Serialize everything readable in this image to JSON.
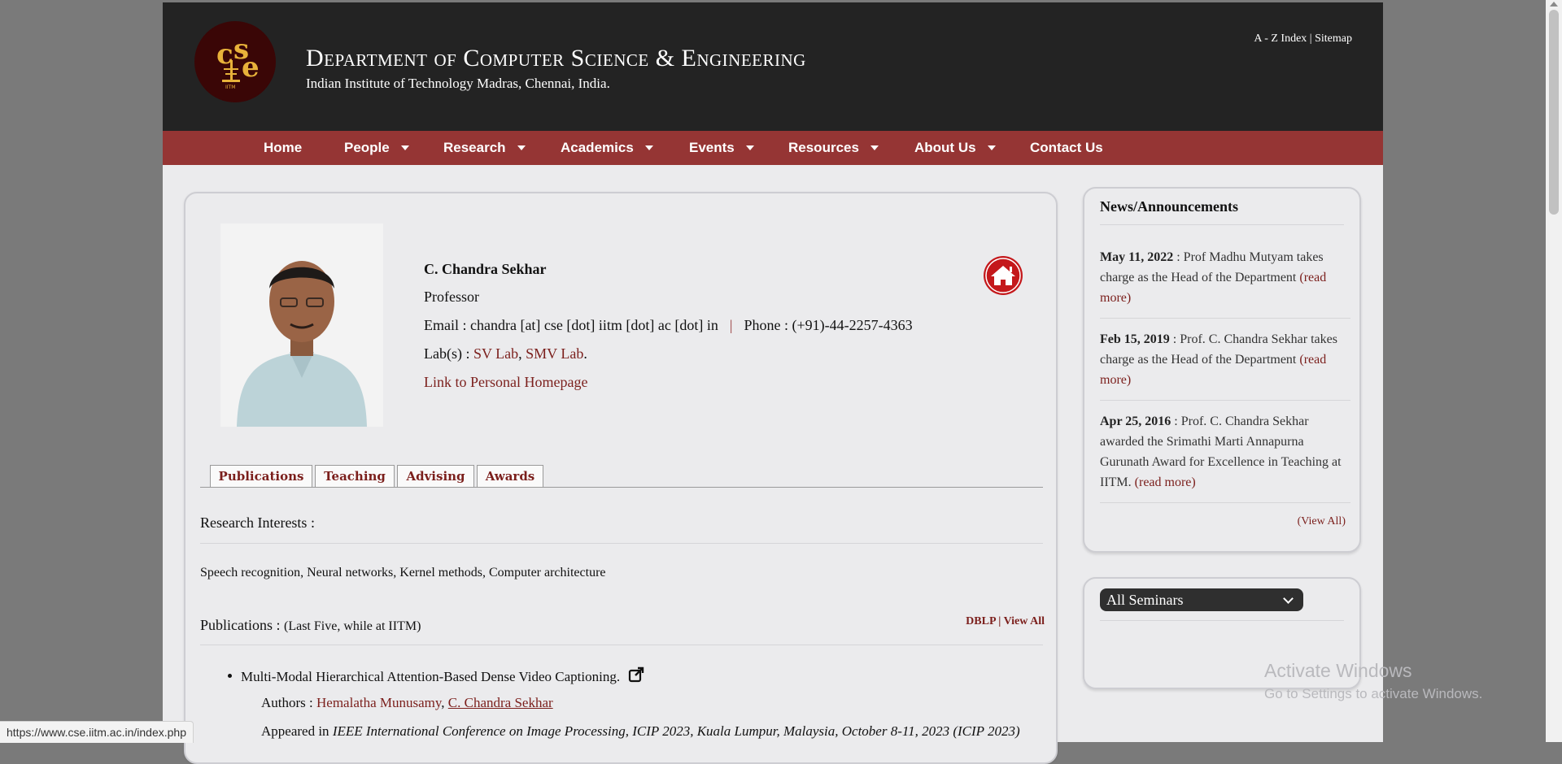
{
  "header": {
    "dept_title": "Department of Computer Science & Engineering",
    "dept_subtitle": "Indian Institute of Technology Madras, Chennai, India.",
    "logo_text": "cse IITM",
    "top_links": [
      "A - Z Index",
      "Sitemap"
    ],
    "top_link_sep": "|"
  },
  "nav": {
    "items": [
      {
        "label": "Home",
        "dropdown": false
      },
      {
        "label": "People",
        "dropdown": true
      },
      {
        "label": "Research",
        "dropdown": true
      },
      {
        "label": "Academics",
        "dropdown": true
      },
      {
        "label": "Events",
        "dropdown": true
      },
      {
        "label": "Resources",
        "dropdown": true
      },
      {
        "label": "About Us",
        "dropdown": true
      },
      {
        "label": "Contact Us",
        "dropdown": false
      }
    ]
  },
  "profile": {
    "name": "C. Chandra Sekhar",
    "title": "Professor",
    "email_label": "Email : chandra [at] cse [dot] iitm [dot] ac [dot] in",
    "email_sep": "|",
    "phone_label": "Phone : (+91)-44-2257-4363",
    "labs_prefix": "Lab(s) :",
    "labs": [
      "SV Lab",
      "SMV Lab"
    ],
    "labs_sep": ",",
    "labs_end": ".",
    "homepage_link": "Link to Personal Homepage",
    "home_icon": "home-icon"
  },
  "tabs": [
    "Publications",
    "Teaching",
    "Advising",
    "Awards"
  ],
  "research": {
    "heading": "Research Interests :",
    "text": "Speech recognition, Neural networks, Kernel methods, Computer architecture"
  },
  "publications": {
    "heading": "Publications :",
    "heading_note": "(Last Five, while at IITM)",
    "links": [
      "DBLP",
      "View All"
    ],
    "links_sep": "|",
    "items": [
      {
        "title": "Multi-Modal Hierarchical Attention-Based Dense Video Captioning.",
        "authors_label": "Authors :",
        "authors": [
          "Hemalatha Munusamy",
          "C. Chandra Sekhar"
        ],
        "authors_sep": ",",
        "venue_prefix": "Appeared in",
        "venue": "IEEE International Conference on Image Processing, ICIP 2023, Kuala Lumpur, Malaysia, October 8-11, 2023 (ICIP 2023)",
        "external_icon": "external-link-icon"
      }
    ]
  },
  "news": {
    "title": "News/Announcements",
    "items": [
      {
        "date": "May 11, 2022",
        "text": "Prof Madhu Mutyam takes charge as the Head of the Department",
        "more": "(read more)"
      },
      {
        "date": "Feb 15, 2019",
        "text": "Prof. C. Chandra Sekhar takes charge as the Head of the Department",
        "more": "(read more)"
      },
      {
        "date": "Apr 25, 2016",
        "text": "Prof. C. Chandra Sekhar awarded the Srimathi Marti Annapurna Gurunath Award for Excellence in Teaching at IITM.",
        "more": "(read more)"
      }
    ],
    "separator": ":",
    "view_all": "(View All)"
  },
  "seminars": {
    "selected": "All Seminars"
  },
  "watermark": {
    "line1": "Activate Windows",
    "line2": "Go to Settings to activate Windows."
  },
  "status_bar": {
    "url": "https://www.cse.iitm.ac.in/index.php"
  },
  "colors": {
    "header_bg": "#232323",
    "nav_bg": "#953534",
    "link": "#7b1f1c",
    "page_bg": "#ebebed"
  }
}
